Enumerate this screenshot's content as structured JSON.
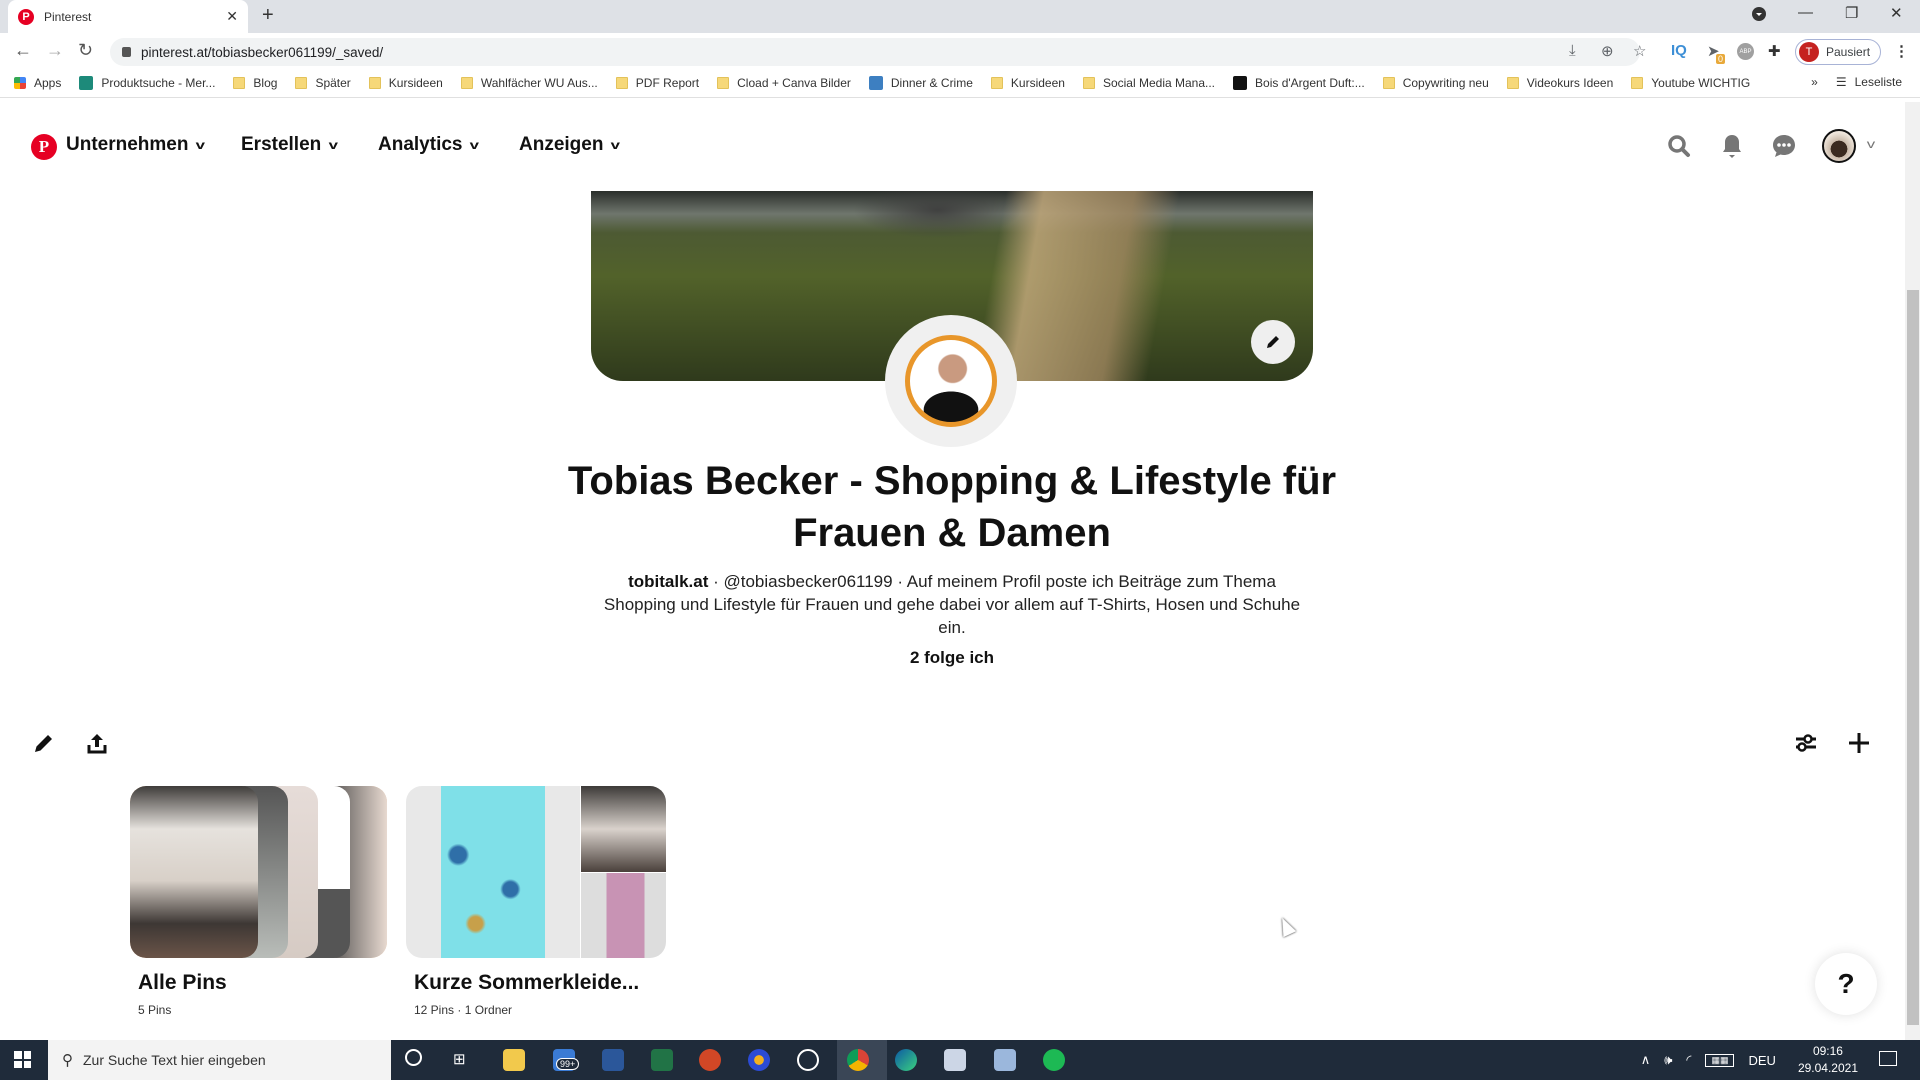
{
  "browser": {
    "tab_title": "Pinterest",
    "new_tab_label": "+",
    "url": "pinterest.at/tobiasbecker061199/_saved/",
    "profile_initial": "T",
    "profile_status": "Pausiert",
    "extension_badge": "0",
    "extensions": [
      "download-icon",
      "zoom-icon",
      "star-icon",
      "iq-icon",
      "bird-extension-icon",
      "abp-icon",
      "puzzle-icon"
    ],
    "bookmarks": [
      {
        "label": "Apps",
        "icon": "apps-grid-icon"
      },
      {
        "label": "Produktsuche - Mer...",
        "icon": "shirt-icon"
      },
      {
        "label": "Blog",
        "icon": "folder-icon"
      },
      {
        "label": "Später",
        "icon": "folder-icon"
      },
      {
        "label": "Kursideen",
        "icon": "folder-icon"
      },
      {
        "label": "Wahlfächer WU Aus...",
        "icon": "folder-icon"
      },
      {
        "label": "PDF Report",
        "icon": "folder-icon"
      },
      {
        "label": "Cload + Canva Bilder",
        "icon": "folder-icon"
      },
      {
        "label": "Dinner & Crime",
        "icon": "id-icon"
      },
      {
        "label": "Kursideen",
        "icon": "folder-icon"
      },
      {
        "label": "Social Media Mana...",
        "icon": "folder-icon"
      },
      {
        "label": "Bois d'Argent Duft:...",
        "icon": "bois-icon"
      },
      {
        "label": "Copywriting neu",
        "icon": "folder-icon"
      },
      {
        "label": "Videokurs Ideen",
        "icon": "folder-icon"
      },
      {
        "label": "Youtube WICHTIG",
        "icon": "folder-icon"
      }
    ],
    "bookmarks_overflow": "»",
    "reading_list": "Leseliste"
  },
  "header": {
    "nav": [
      {
        "label": "Unternehmen"
      },
      {
        "label": "Erstellen"
      },
      {
        "label": "Analytics"
      },
      {
        "label": "Anzeigen"
      }
    ],
    "brand_color": "#e60023"
  },
  "profile": {
    "title": "Tobias Becker - Shopping & Lifestyle für Frauen & Damen",
    "website": "tobitalk.at",
    "handle": "@tobiasbecker061199",
    "bio": "Auf meinem Profil poste ich Beiträge zum Thema Shopping und Lifestyle für Frauen und gehe dabei vor allem auf T-Shirts, Hosen und Schuhe ein.",
    "separator": " · ",
    "following": "2 folge ich"
  },
  "boards": [
    {
      "name": "Alle Pins",
      "meta": "5 Pins"
    },
    {
      "name": "Kurze Sommerkleide...",
      "meta": "12 Pins · 1 Ordner"
    }
  ],
  "help_label": "?",
  "taskbar": {
    "search_placeholder": "Zur Suche Text hier eingeben",
    "mail_badge": "99+",
    "language": "DEU",
    "time": "09:16",
    "date": "29.04.2021"
  }
}
